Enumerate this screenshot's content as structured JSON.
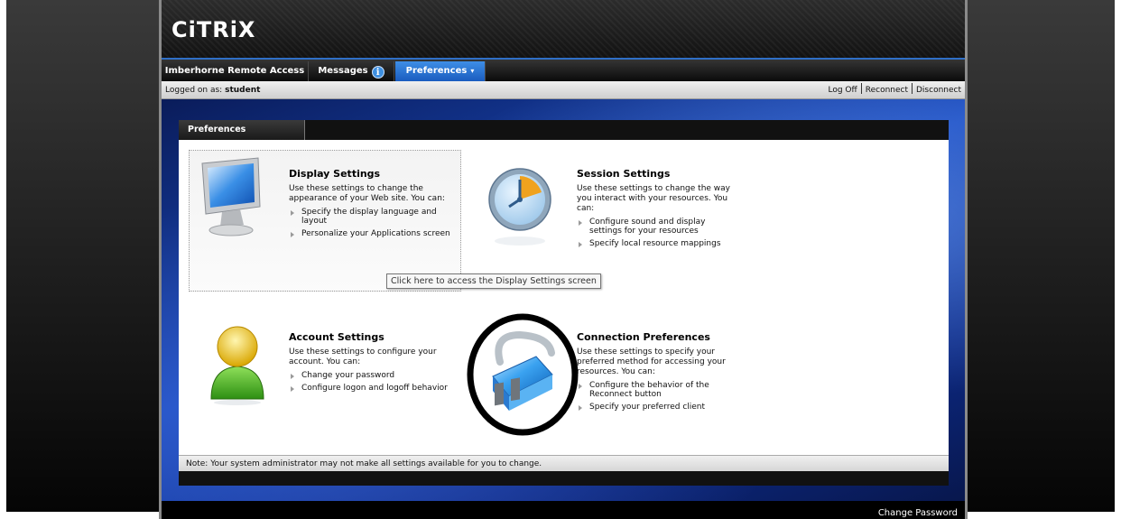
{
  "brand": {
    "logo": "CiTRiX"
  },
  "nav": {
    "tabs": [
      {
        "label": "Imberhorne Remote Access"
      },
      {
        "label": "Messages",
        "badge": "i"
      },
      {
        "label": "Preferences",
        "caret": "▾"
      }
    ]
  },
  "status": {
    "logged_on_prefix": "Logged on as:",
    "user": "student",
    "links": [
      "Log Off",
      "Reconnect",
      "Disconnect"
    ]
  },
  "panel": {
    "title": "Preferences",
    "sections": [
      {
        "title": "Display Settings",
        "description": "Use these settings to change the appearance of your Web site. You can:",
        "items": [
          "Specify the display language and layout",
          "Personalize your Applications screen"
        ],
        "icon": "monitor-icon"
      },
      {
        "title": "Session Settings",
        "description": "Use these settings to change the way you interact with your resources. You can:",
        "items": [
          "Configure sound and display settings for your resources",
          "Specify local resource mappings"
        ],
        "icon": "clock-icon"
      },
      {
        "title": "Account Settings",
        "description": "Use these settings to configure your account. You can:",
        "items": [
          "Change your password",
          "Configure logon and logoff behavior"
        ],
        "icon": "user-icon"
      },
      {
        "title": "Connection Preferences",
        "description": "Use these settings to specify your preferred method for accessing your resources. You can:",
        "items": [
          "Configure the behavior of the Reconnect button",
          "Specify your preferred client"
        ],
        "icon": "plug-icon"
      }
    ],
    "tooltip": "Click here to access the Display Settings screen",
    "note": "Note: Your system administrator may not make all settings available for you to change."
  },
  "footer": {
    "change_password": "Change Password"
  },
  "colors": {
    "accent_blue": "#1a5cbf",
    "header_dark": "#121212",
    "annotation_ring": "#000000"
  }
}
